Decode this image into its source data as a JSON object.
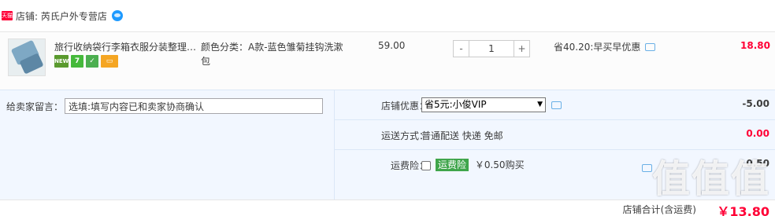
{
  "shop": {
    "badge": "天猫",
    "name": "店铺: 芮氏户外专营店"
  },
  "item": {
    "title": "旅行收纳袋行李箱衣服分装整理…",
    "tags": [
      "new",
      "7",
      "and",
      "card"
    ],
    "sku": "颜色分类：A款-蓝色雏菊挂钩洗漱包",
    "price": "59.00",
    "qty": "1",
    "qty_minus": "-",
    "qty_plus": "+",
    "save": "省40.20:早买早优惠",
    "subtotal": "18.80"
  },
  "memo": {
    "label": "给卖家留言：",
    "value": "选填:填写内容已和卖家协商确认"
  },
  "coupon": {
    "label": "店铺优惠：",
    "selected": "省5元:小俊VIP",
    "amount": "-5.00"
  },
  "shipping": {
    "label": "运送方式：",
    "value": "普通配送 快递 免邮",
    "amount": "0.00"
  },
  "insurance": {
    "label": "运费险：",
    "tag": "运费险",
    "value": "￥0.50购买",
    "amount": "0.50"
  },
  "total": {
    "label": "店铺合计(含运费)",
    "value": "￥13.80"
  },
  "watermark": "值值值",
  "colors": {
    "price_red": "#ff0036",
    "panel_bg": "#f2f7ff",
    "insurance_green": "#3fa54b"
  }
}
